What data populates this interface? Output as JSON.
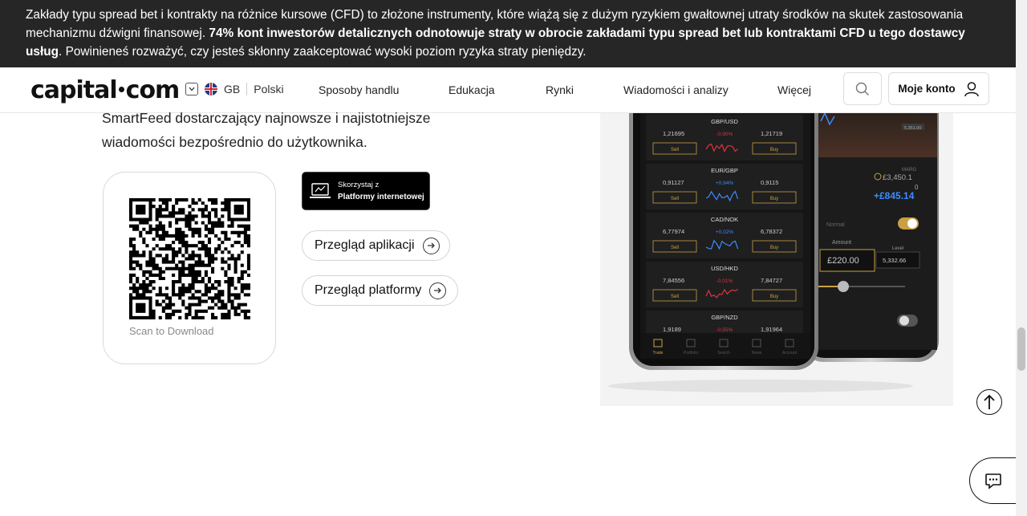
{
  "risk_banner": {
    "text_part1": "Zakłady typu spread bet i kontrakty na różnice kursowe (CFD) to złożone instrumenty, które wiążą się z dużym ryzykiem gwałtownej utraty środków na skutek zastosowania mechanizmu dźwigni finansowej. ",
    "text_bold": "74% kont inwestorów detalicznych odnotowuje straty w obrocie zakładami typu spread bet lub kontraktami CFD u tego dostawcy usług",
    "text_part2": ". Powinieneś rozważyć, czy jesteś skłonny zaakceptować wysoki poziom ryzyka straty pieniędzy."
  },
  "header": {
    "logo_left": "capital",
    "logo_right": "com",
    "region_code": "GB",
    "language": "Polski",
    "nav": [
      "Sposoby handlu",
      "Edukacja",
      "Rynki",
      "Wiadomości i analizy",
      "Więcej"
    ],
    "account_label": "Moje konto"
  },
  "main": {
    "description": "SmartFeed dostarczający najnowsze i najistotniejsze wiadomości bezpośrednio do użytkownika.",
    "qr_caption": "Scan to Download",
    "platform_badge_line1": "Skorzystaj z",
    "platform_badge_line2": "Platformy internetowej",
    "app_review_label": "Przegląd aplikacji",
    "platform_review_label": "Przegląd platformy"
  },
  "phone_app": {
    "pairs": [
      {
        "name": "GBP/USD",
        "sell": "1,21695",
        "change": "-0,90%",
        "buy": "1,21719",
        "direction": "down"
      },
      {
        "name": "EUR/GBP",
        "sell": "0,91127",
        "change": "+0,94%",
        "buy": "0,9115",
        "direction": "up"
      },
      {
        "name": "CAD/NOK",
        "sell": "6,77974",
        "change": "+0,02%",
        "buy": "6,78372",
        "direction": "up"
      },
      {
        "name": "USD/HKD",
        "sell": "7,84556",
        "change": "-0,01%",
        "buy": "7,84727",
        "direction": "down"
      },
      {
        "name": "GBP/NZD",
        "sell": "1,9189",
        "change": "-0,55%",
        "buy": "1,91964",
        "direction": "down"
      }
    ],
    "sell_label": "Sell",
    "buy_label": "Buy",
    "tabbar": [
      "Trade",
      "Portfolio",
      "Search",
      "News",
      "Account"
    ],
    "second_phone": {
      "margin_label": "MARG",
      "margin_value": "£3,450.1",
      "zero": "0",
      "pnl": "+£845.14",
      "mode": "Normal",
      "amount_label": "Amount",
      "level_label": "Level",
      "amount_value": "£220.00",
      "level_value": "5,332.66",
      "chart_price": "5,351.00"
    }
  },
  "colors": {
    "banner_bg": "#262626",
    "accent_up": "#3b8cff",
    "accent_down": "#e0323c",
    "gold": "#c9a043"
  }
}
